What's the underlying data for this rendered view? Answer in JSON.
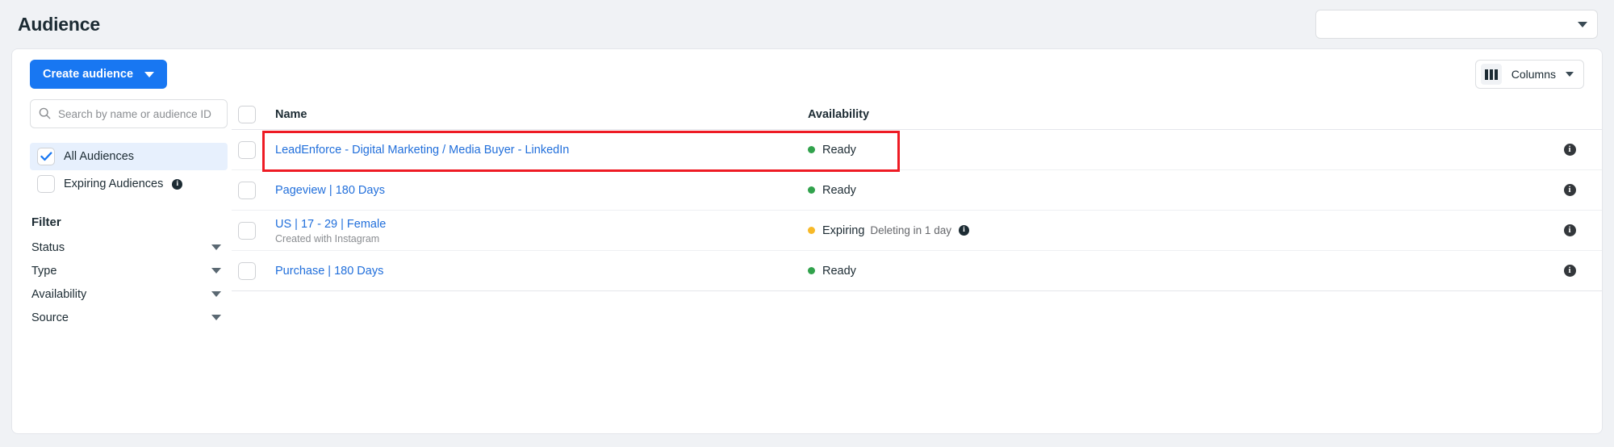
{
  "header": {
    "title": "Audience",
    "account_selector": {
      "value": "",
      "icon": "chevron-down-icon"
    }
  },
  "toolbar": {
    "create_label": "Create audience",
    "create_icon": "chevron-down-icon",
    "columns_label": "Columns",
    "columns_icon": "columns-icon",
    "columns_caret": "chevron-down-icon"
  },
  "sidebar": {
    "search": {
      "placeholder": "Search by name or audience ID",
      "value": "",
      "icon": "search-icon"
    },
    "audience_scopes": [
      {
        "label": "All Audiences",
        "checked": true,
        "active": true,
        "info": false
      },
      {
        "label": "Expiring Audiences",
        "checked": false,
        "active": false,
        "info": true,
        "info_glyph": "i"
      }
    ],
    "filter_title": "Filter",
    "filters": [
      {
        "label": "Status",
        "icon": "chevron-down-icon"
      },
      {
        "label": "Type",
        "icon": "chevron-down-icon"
      },
      {
        "label": "Availability",
        "icon": "chevron-down-icon"
      },
      {
        "label": "Source",
        "icon": "chevron-down-icon"
      }
    ]
  },
  "table": {
    "columns": {
      "name": "Name",
      "availability": "Availability"
    },
    "select_all_checked": false,
    "info_glyph": "i",
    "rows": [
      {
        "name": "LeadEnforce - Digital Marketing / Media Buyer - LinkedIn",
        "subtitle": "",
        "checked": false,
        "availability": "Ready",
        "availability_detail": "",
        "status_color": "#31a24c",
        "has_detail_info": false,
        "highlighted": true
      },
      {
        "name": "Pageview |  180 Days",
        "subtitle": "",
        "checked": false,
        "availability": "Ready",
        "availability_detail": "",
        "status_color": "#31a24c",
        "has_detail_info": false,
        "highlighted": false
      },
      {
        "name": "US | 17 - 29 | Female",
        "subtitle": "Created with Instagram",
        "checked": false,
        "availability": "Expiring",
        "availability_detail": "Deleting in 1 day",
        "status_color": "#f7b928",
        "has_detail_info": true,
        "highlighted": false
      },
      {
        "name": "Purchase | 180 Days",
        "subtitle": "",
        "checked": false,
        "availability": "Ready",
        "availability_detail": "",
        "status_color": "#31a24c",
        "has_detail_info": false,
        "highlighted": false
      }
    ]
  },
  "colors": {
    "brand_blue": "#1877f2",
    "link_blue": "#216fdb",
    "ready_green": "#31a24c",
    "expiring_amber": "#f7b928",
    "highlight_red": "#ee1b24",
    "page_bg": "#f0f2f5"
  }
}
